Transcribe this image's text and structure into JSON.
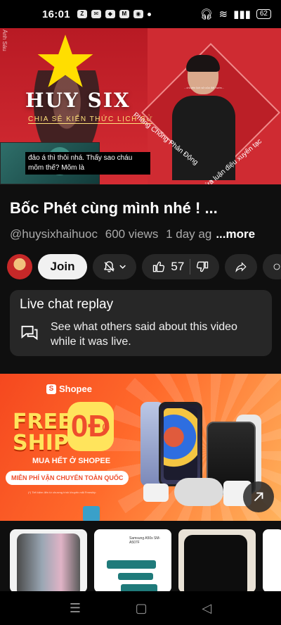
{
  "status_bar": {
    "time": "16:01",
    "battery": "62",
    "app_icons": [
      "zalo-icon",
      "chat-icon",
      "shield-icon",
      "momo-icon",
      "messenger-icon"
    ]
  },
  "video": {
    "side_text": "Ảnh Sáu",
    "brand": "HUY SIX",
    "brand_subtitle": "CHIA SẺ KIẾN THỨC LỊCH SỬ",
    "arc_text_left": "Phòng Chống Phản Động",
    "arc_text_right": "Lừa luận điệu xuyên tạc",
    "note_text": "...chuyện lịch sử của đất nước...",
    "caption": "đảo á thì thôi nhá. Thấy sao cháu mõm thế? Mõm là"
  },
  "title": "Bốc Phét cùng mình nhé ! ...",
  "meta": {
    "channel": "@huysixhaihuoc",
    "views": "600 views",
    "age": "1 day ag",
    "more_label": "...more"
  },
  "actions": {
    "join_label": "Join",
    "like_count": "57"
  },
  "live_chat": {
    "heading": "Live chat replay",
    "description": "See what others said about this video while it was live."
  },
  "ad": {
    "brand": "Shopee",
    "free_line1": "FREE",
    "free_line2": "SHIP",
    "zero": "0Đ",
    "zero_mark": "(*)",
    "subhead": "MUA HẾT Ở SHOPEE",
    "banner": "MIỄN PHÍ VẬN CHUYỂN TOÀN QUỐC",
    "tiny_text": "(*) Tiết kiệm đến từ chương trình khuyến mãi Freeship"
  },
  "products": {
    "p2_label": "Samsung A50s SM-A507F"
  },
  "colors": {
    "background": "#0f0f0f",
    "card": "#272727",
    "video_red": "#c8202a",
    "shopee_orange": "#ee4d2d",
    "star_yellow": "#ffde00"
  }
}
